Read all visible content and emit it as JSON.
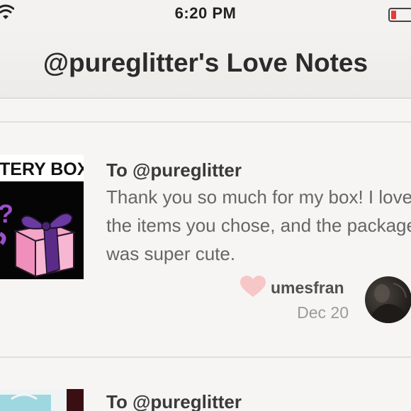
{
  "status_bar": {
    "time": "6:20 PM",
    "icons": [
      "wifi-icon",
      "battery-icon"
    ],
    "battery_color": "#e63b3b"
  },
  "header": {
    "title": "@pureglitter's Love Notes"
  },
  "notes": [
    {
      "recipient": "To @pureglitter",
      "message": "Thank you so much for my box! I love the items you chose, and the package was super cute.",
      "image_text": "TERY BOX!",
      "sender": "umesfran",
      "date": "Dec 20",
      "heart_color": "#f7c6c6"
    },
    {
      "recipient": "To @pureglitter"
    }
  ]
}
